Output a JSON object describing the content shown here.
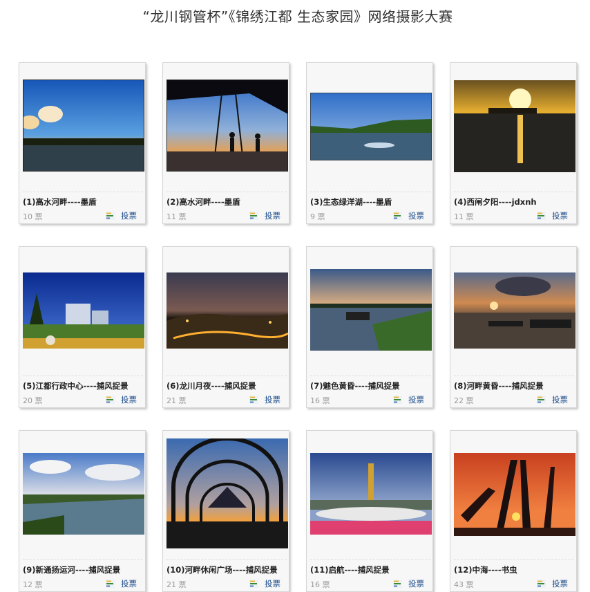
{
  "page": {
    "title": "“龙川钢管杯”《锦绣江都 生态家园》网络摄影大赛"
  },
  "vote_label": "投票",
  "entries": [
    {
      "caption": "(1)高水河畔----墨盾",
      "votes": "10 票"
    },
    {
      "caption": "(2)高水河畔----墨盾",
      "votes": "11 票"
    },
    {
      "caption": "(3)生态绿洋湖----墨盾",
      "votes": "9 票"
    },
    {
      "caption": "(4)西闸夕阳----jdxnh",
      "votes": "11 票"
    },
    {
      "caption": "(5)江都行政中心----捕风捉景",
      "votes": "20 票"
    },
    {
      "caption": "(6)龙川月夜----捕风捉景",
      "votes": "21 票"
    },
    {
      "caption": "(7)魅色黄昏----捕风捉景",
      "votes": "16 票"
    },
    {
      "caption": "(8)河畔黄昏----捕风捉景",
      "votes": "22 票"
    },
    {
      "caption": "(9)新通扬运河----捕风捉景",
      "votes": "12 票"
    },
    {
      "caption": "(10)河畔休闲广场----捕风捉景",
      "votes": "21 票"
    },
    {
      "caption": "(11)启航----捕风捉景",
      "votes": "16 票"
    },
    {
      "caption": "(12)中海----书虫",
      "votes": "43 票"
    }
  ]
}
